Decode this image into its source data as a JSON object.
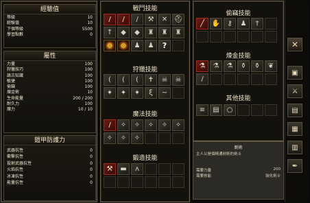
{
  "experience": {
    "title": "經驗值",
    "rows": [
      {
        "label": "等級",
        "value": "10"
      },
      {
        "label": "經驗值",
        "value": "10"
      },
      {
        "label": "下個等級",
        "value": "5500"
      },
      {
        "label": "學習點數",
        "value": "0"
      }
    ]
  },
  "attributes": {
    "title": "屬性",
    "rows": [
      {
        "label": "力量",
        "value": "100"
      },
      {
        "label": "狩獵技巧",
        "value": "100"
      },
      {
        "label": "論古知識",
        "value": "100"
      },
      {
        "label": "敏捷",
        "value": "100"
      },
      {
        "label": "偷竊",
        "value": "100"
      },
      {
        "label": "煉金術",
        "value": "10"
      },
      {
        "label": "生命能量",
        "value": "200 / 200"
      },
      {
        "label": "耐久力",
        "value": "100"
      },
      {
        "label": "魔力",
        "value": "10 / 10"
      }
    ]
  },
  "armor": {
    "title": "鎧甲防護力",
    "rows": [
      {
        "label": "武器抗性",
        "value": "0"
      },
      {
        "label": "衝擊抗性",
        "value": "0"
      },
      {
        "label": "投射武器抗性",
        "value": "0"
      },
      {
        "label": "火焰抗性",
        "value": "0"
      },
      {
        "label": "冰凍抗性",
        "value": "0"
      },
      {
        "label": "能量抗性",
        "value": "0"
      }
    ]
  },
  "sections": {
    "combat": {
      "title": "戰鬥技能",
      "icons": [
        "sword-icon",
        "sword-icon",
        "sword-icon",
        "axe-icon",
        "crossed-swords-icon",
        "helmet-icon",
        "spear-icon",
        "shield-icon",
        "shield-icon",
        "armor-icon",
        "armor-icon",
        "armor-icon",
        "gold-coin-icon",
        "gold-coin-icon",
        "figure-icon",
        "figure-icon",
        "question-icon",
        "empty-slot"
      ]
    },
    "hunting": {
      "title": "狩獵技能",
      "icons": [
        "bow-icon",
        "bow-icon",
        "bow-icon",
        "crossbow-icon",
        "skull-icon",
        "skull-icon",
        "paw-icon",
        "paw-icon",
        "paw-icon",
        "claw-icon",
        "feather-icon",
        "empty-slot"
      ]
    },
    "magic": {
      "title": "魔法技能",
      "icons": [
        "staff-icon",
        "rune-icon",
        "rune-icon",
        "rune-icon",
        "rune-icon",
        "rune-icon",
        "rune-icon",
        "rune-icon",
        "rune-icon",
        "empty-slot",
        "empty-slot",
        "empty-slot"
      ]
    },
    "smithing": {
      "title": "鍛造技能",
      "icons": [
        "hammer-icon",
        "anvil-icon",
        "tongs-icon",
        "empty-slot",
        "empty-slot",
        "empty-slot",
        "empty-slot",
        "empty-slot",
        "empty-slot",
        "empty-slot",
        "empty-slot",
        "empty-slot"
      ]
    },
    "thief": {
      "title": "偷竊技能",
      "icons": [
        "lockpick-icon",
        "hand-icon",
        "key-icon",
        "sneak-icon",
        "dagger-icon",
        "empty-slot",
        "empty-slot",
        "empty-slot",
        "empty-slot",
        "empty-slot",
        "empty-slot",
        "empty-slot"
      ]
    },
    "alchemy": {
      "title": "煉金技能",
      "icons": [
        "flask-icon",
        "flask-icon",
        "flask-icon",
        "potion-icon",
        "potion-icon",
        "herb-icon",
        "knife-icon",
        "empty-slot",
        "empty-slot",
        "empty-slot",
        "empty-slot",
        "empty-slot"
      ]
    },
    "other": {
      "title": "其他技能",
      "icons": [
        "scroll-icon",
        "book-icon",
        "ring-icon",
        "empty-slot",
        "empty-slot",
        "empty-slot"
      ]
    }
  },
  "description": {
    "title": "劍術",
    "line": "主人公是個精通劍術的劍士",
    "req1_label": "需要力量",
    "req1_value": "200",
    "req2_label": "需要技能",
    "req2_value": "強化劍士"
  },
  "side_buttons": [
    "close-icon",
    "inventory-icon",
    "skills-icon",
    "map-icon",
    "journal-icon",
    "quest-icon",
    "quill-icon"
  ]
}
